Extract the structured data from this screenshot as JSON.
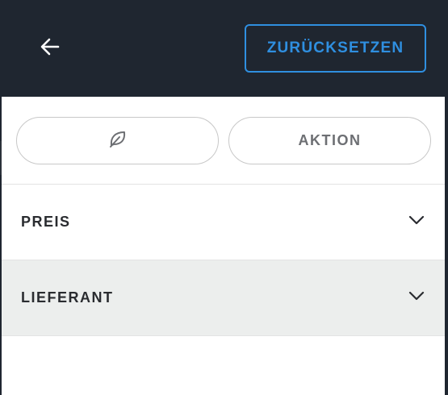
{
  "header": {
    "back_icon": "arrow-left-icon",
    "reset_label": "ZURÜCKSETZEN",
    "accent_color": "#2f8fe0",
    "background_color": "#1f2630"
  },
  "chips": [
    {
      "icon": "leaf-icon",
      "label": ""
    },
    {
      "label": "AKTION"
    }
  ],
  "filters": [
    {
      "label": "PREIS",
      "icon": "chevron-down-icon",
      "highlighted": false
    },
    {
      "label": "LIEFERANT",
      "icon": "chevron-down-icon",
      "highlighted": true
    }
  ]
}
